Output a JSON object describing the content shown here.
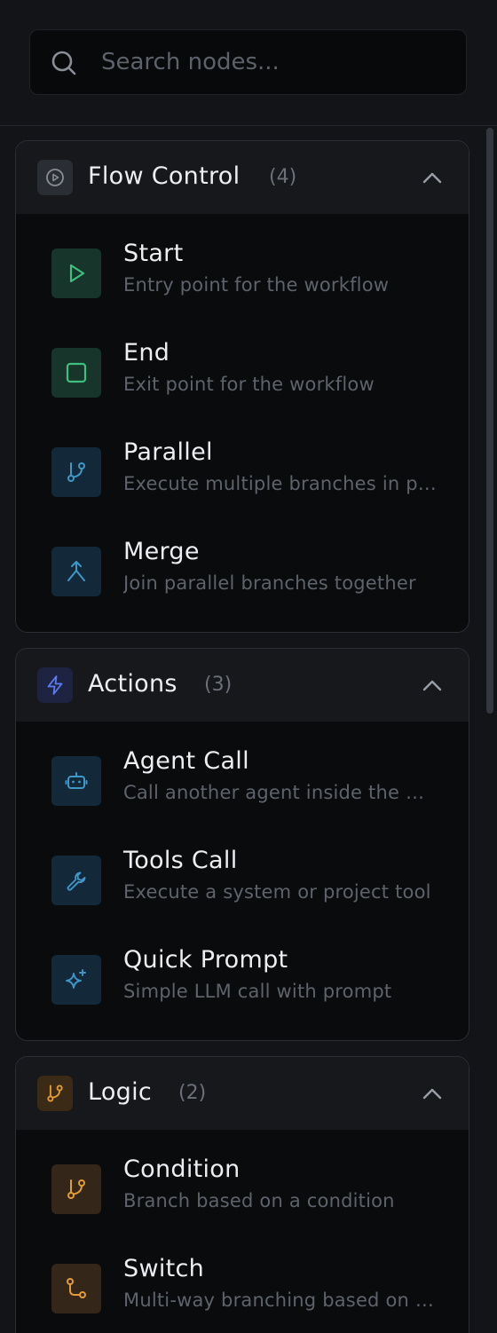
{
  "search": {
    "placeholder": "Search nodes..."
  },
  "colors": {
    "background": "#121418",
    "green": "#3fbf7f",
    "blue": "#3f97c8",
    "orange": "#e39b35",
    "purple_blue": "#5a7cf5",
    "gray": "#8a8f97"
  },
  "groups": [
    {
      "title": "Flow Control",
      "count": "(4)",
      "icon": "play-circle-icon",
      "items": [
        {
          "name": "Start",
          "desc": "Entry point for the workflow",
          "icon": "play-icon"
        },
        {
          "name": "End",
          "desc": "Exit point for the workflow",
          "icon": "square-icon"
        },
        {
          "name": "Parallel",
          "desc": "Execute multiple branches in parallel",
          "icon": "git-branch-icon"
        },
        {
          "name": "Merge",
          "desc": "Join parallel branches together",
          "icon": "merge-icon"
        }
      ]
    },
    {
      "title": "Actions",
      "count": "(3)",
      "icon": "lightning-icon",
      "items": [
        {
          "name": "Agent Call",
          "desc": "Call another agent inside the workflow",
          "icon": "bot-icon"
        },
        {
          "name": "Tools Call",
          "desc": "Execute a system or project tool",
          "icon": "wrench-icon"
        },
        {
          "name": "Quick Prompt",
          "desc": "Simple LLM call with prompt",
          "icon": "sparkles-icon"
        }
      ]
    },
    {
      "title": "Logic",
      "count": "(2)",
      "icon": "git-branch-icon",
      "items": [
        {
          "name": "Condition",
          "desc": "Branch based on a condition",
          "icon": "git-branch-icon"
        },
        {
          "name": "Switch",
          "desc": "Multi-way branching based on value",
          "icon": "switch-icon"
        }
      ]
    }
  ]
}
